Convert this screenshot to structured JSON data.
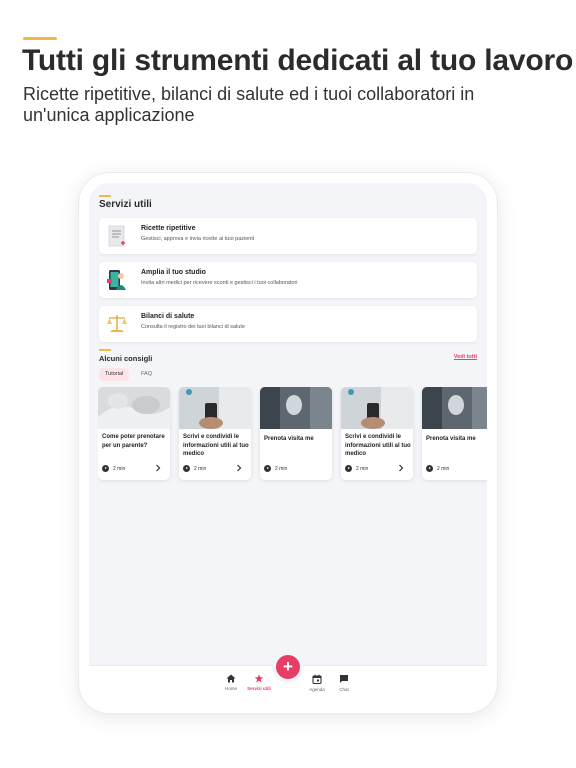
{
  "headline": "Tutti gli strumenti dedicati al tuo lavoro",
  "subline": "Ricette ripetitive, bilanci di salute ed i tuoi collaboratori in un'unica applicazione",
  "section_title": "Servizi utili",
  "services": [
    {
      "title": "Ricette ripetitive",
      "desc": "Gestisci, approva e invia ricette ai tuoi pazienti",
      "icon": "prescription-icon"
    },
    {
      "title": "Amplia il tuo studio",
      "desc": "Invita altri medici per ricevere sconti e gestisci i tuoi collaboratori",
      "icon": "doctor-phone-icon"
    },
    {
      "title": "Bilanci di salute",
      "desc": "Consulta il registro dei tuoi bilanci di salute",
      "icon": "scale-icon"
    }
  ],
  "tips": {
    "title": "Alcuni consigli",
    "see_all": "Vedi tutti",
    "tabs": [
      "Tutorial",
      "FAQ"
    ],
    "active_tab": "Tutorial"
  },
  "cards": [
    {
      "title": "Come poter prenotare per un parente?",
      "duration": "2 min",
      "has_arrow": true
    },
    {
      "title": "Scrivi e condividi le informazioni utili al tuo medico",
      "duration": "2 min",
      "has_arrow": true
    },
    {
      "title": "Prenota visita me",
      "duration": "2 min",
      "has_arrow": false
    },
    {
      "title": "Scrivi e condividi le informazioni utili al tuo medico",
      "duration": "2 min",
      "has_arrow": true
    },
    {
      "title": "Prenota visita me",
      "duration": "2 min",
      "has_arrow": false
    }
  ],
  "nav": {
    "home": "Home",
    "services": "Servizi utili",
    "agenda": "Agenda",
    "chat": "Chat",
    "fab": "+"
  },
  "colors": {
    "accent": "#e63e66",
    "highlight": "#f2b84a",
    "background": "#f4f5f9"
  }
}
